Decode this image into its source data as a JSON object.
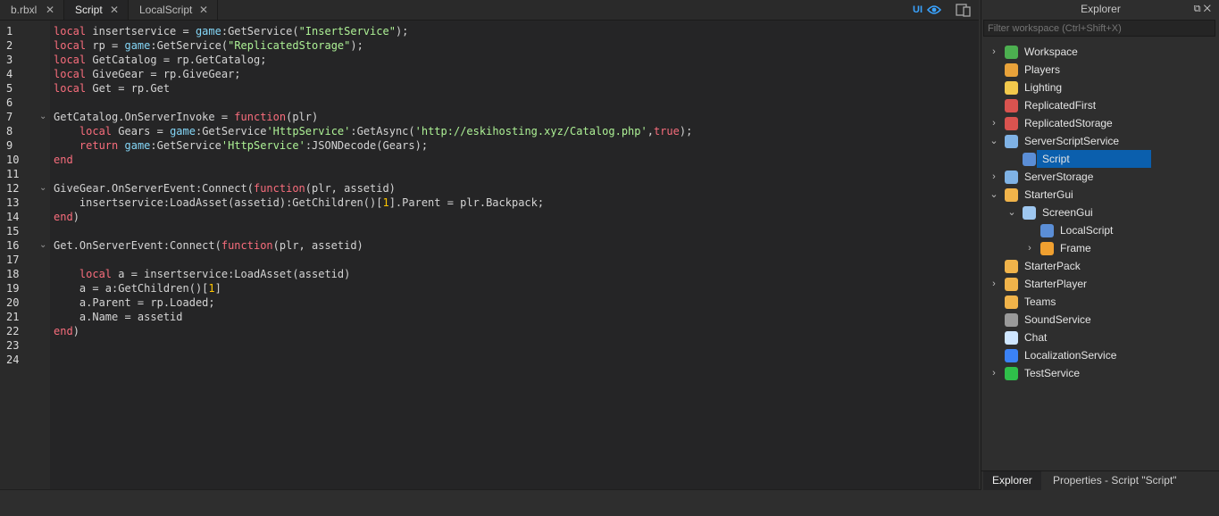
{
  "tabs": [
    {
      "label": "b.rbxl",
      "close": "✕"
    },
    {
      "label": "Script",
      "close": "✕"
    },
    {
      "label": "LocalScript",
      "close": "✕"
    }
  ],
  "toolbar": {
    "ui_toggle": "UI"
  },
  "editor": {
    "line_numbers": [
      "1",
      "2",
      "3",
      "4",
      "5",
      "6",
      "7",
      "8",
      "9",
      "10",
      "11",
      "12",
      "13",
      "14",
      "15",
      "16",
      "17",
      "18",
      "19",
      "20",
      "21",
      "22",
      "23",
      "24"
    ],
    "lines": [
      [
        {
          "t": "kw",
          "v": "local"
        },
        {
          "t": "op",
          "v": " insertservice = "
        },
        {
          "t": "gl",
          "v": "game"
        },
        {
          "t": "op",
          "v": ":GetService("
        },
        {
          "t": "st",
          "v": "\"InsertService\""
        },
        {
          "t": "op",
          "v": ");"
        }
      ],
      [
        {
          "t": "kw",
          "v": "local"
        },
        {
          "t": "op",
          "v": " rp = "
        },
        {
          "t": "gl",
          "v": "game"
        },
        {
          "t": "op",
          "v": ":GetService("
        },
        {
          "t": "st",
          "v": "\"ReplicatedStorage\""
        },
        {
          "t": "op",
          "v": ");"
        }
      ],
      [
        {
          "t": "kw",
          "v": "local"
        },
        {
          "t": "op",
          "v": " GetCatalog = rp.GetCatalog;"
        }
      ],
      [
        {
          "t": "kw",
          "v": "local"
        },
        {
          "t": "op",
          "v": " GiveGear = rp.GiveGear;"
        }
      ],
      [
        {
          "t": "kw",
          "v": "local"
        },
        {
          "t": "op",
          "v": " Get = rp.Get"
        }
      ],
      [],
      [
        {
          "t": "op",
          "v": "GetCatalog.OnServerInvoke = "
        },
        {
          "t": "kw",
          "v": "function"
        },
        {
          "t": "op",
          "v": "(plr)"
        }
      ],
      [
        {
          "t": "op",
          "v": "    "
        },
        {
          "t": "kw",
          "v": "local"
        },
        {
          "t": "op",
          "v": " Gears = "
        },
        {
          "t": "gl",
          "v": "game"
        },
        {
          "t": "op",
          "v": ":GetService"
        },
        {
          "t": "st",
          "v": "'HttpService'"
        },
        {
          "t": "op",
          "v": ":GetAsync("
        },
        {
          "t": "st",
          "v": "'http://eskihosting.xyz/Catalog.php'"
        },
        {
          "t": "op",
          "v": ","
        },
        {
          "t": "kw",
          "v": "true"
        },
        {
          "t": "op",
          "v": ");"
        }
      ],
      [
        {
          "t": "op",
          "v": "    "
        },
        {
          "t": "kw",
          "v": "return"
        },
        {
          "t": "op",
          "v": " "
        },
        {
          "t": "gl",
          "v": "game"
        },
        {
          "t": "op",
          "v": ":GetService"
        },
        {
          "t": "st",
          "v": "'HttpService'"
        },
        {
          "t": "op",
          "v": ":JSONDecode(Gears);"
        }
      ],
      [
        {
          "t": "kw",
          "v": "end"
        }
      ],
      [],
      [
        {
          "t": "op",
          "v": "GiveGear.OnServerEvent:Connect("
        },
        {
          "t": "kw",
          "v": "function"
        },
        {
          "t": "op",
          "v": "(plr, assetid)"
        }
      ],
      [
        {
          "t": "op",
          "v": "    insertservice:LoadAsset(assetid):GetChildren()["
        },
        {
          "t": "nm",
          "v": "1"
        },
        {
          "t": "op",
          "v": "].Parent = plr.Backpack;"
        }
      ],
      [
        {
          "t": "kw",
          "v": "end"
        },
        {
          "t": "op",
          "v": ")"
        }
      ],
      [],
      [
        {
          "t": "op",
          "v": "Get.OnServerEvent:Connect("
        },
        {
          "t": "kw",
          "v": "function"
        },
        {
          "t": "op",
          "v": "(plr, assetid)"
        }
      ],
      [],
      [
        {
          "t": "op",
          "v": "    "
        },
        {
          "t": "kw",
          "v": "local"
        },
        {
          "t": "op",
          "v": " a = insertservice:LoadAsset(assetid)"
        }
      ],
      [
        {
          "t": "op",
          "v": "    a = a:GetChildren()["
        },
        {
          "t": "nm",
          "v": "1"
        },
        {
          "t": "op",
          "v": "]"
        }
      ],
      [
        {
          "t": "op",
          "v": "    a.Parent = rp.Loaded;"
        }
      ],
      [
        {
          "t": "op",
          "v": "    a.Name = assetid"
        }
      ],
      [
        {
          "t": "kw",
          "v": "end"
        },
        {
          "t": "op",
          "v": ")"
        }
      ],
      [],
      []
    ],
    "fold_lines": [
      7,
      12,
      16
    ]
  },
  "explorer": {
    "title": "Explorer",
    "controls": "⧉ ✕",
    "filter_placeholder": "Filter workspace (Ctrl+Shift+X)",
    "items": [
      {
        "label": "Workspace",
        "depth": 0,
        "chev": "right",
        "icon": "workspace-icon",
        "color": "#4caf50"
      },
      {
        "label": "Players",
        "depth": 0,
        "chev": "",
        "icon": "players-icon",
        "color": "#e8a23a"
      },
      {
        "label": "Lighting",
        "depth": 0,
        "chev": "",
        "icon": "lighting-icon",
        "color": "#f2c94c"
      },
      {
        "label": "ReplicatedFirst",
        "depth": 0,
        "chev": "",
        "icon": "replicated-first-icon",
        "color": "#d9534f"
      },
      {
        "label": "ReplicatedStorage",
        "depth": 0,
        "chev": "right",
        "icon": "replicated-storage-icon",
        "color": "#d9534f"
      },
      {
        "label": "ServerScriptService",
        "depth": 0,
        "chev": "down",
        "icon": "server-script-service-icon",
        "color": "#7fb2e5"
      },
      {
        "label": "Script",
        "depth": 1,
        "chev": "",
        "icon": "script-icon",
        "color": "#5b8ed6",
        "selected": true
      },
      {
        "label": "ServerStorage",
        "depth": 0,
        "chev": "right",
        "icon": "server-storage-icon",
        "color": "#7fb2e5"
      },
      {
        "label": "StarterGui",
        "depth": 0,
        "chev": "down",
        "icon": "starter-gui-icon",
        "color": "#f0b34a"
      },
      {
        "label": "ScreenGui",
        "depth": 1,
        "chev": "down",
        "icon": "screen-gui-icon",
        "color": "#9ec7f0"
      },
      {
        "label": "LocalScript",
        "depth": 2,
        "chev": "",
        "icon": "local-script-icon",
        "color": "#5b8ed6"
      },
      {
        "label": "Frame",
        "depth": 2,
        "chev": "right",
        "icon": "frame-icon",
        "color": "#f0a030"
      },
      {
        "label": "StarterPack",
        "depth": 0,
        "chev": "",
        "icon": "starter-pack-icon",
        "color": "#f0b34a"
      },
      {
        "label": "StarterPlayer",
        "depth": 0,
        "chev": "right",
        "icon": "starter-player-icon",
        "color": "#f0b34a"
      },
      {
        "label": "Teams",
        "depth": 0,
        "chev": "",
        "icon": "teams-icon",
        "color": "#f0b34a"
      },
      {
        "label": "SoundService",
        "depth": 0,
        "chev": "",
        "icon": "sound-service-icon",
        "color": "#9a9a9a"
      },
      {
        "label": "Chat",
        "depth": 0,
        "chev": "",
        "icon": "chat-icon",
        "color": "#cfe6ff"
      },
      {
        "label": "LocalizationService",
        "depth": 0,
        "chev": "",
        "icon": "localization-service-icon",
        "color": "#3b82f6"
      },
      {
        "label": "TestService",
        "depth": 0,
        "chev": "right",
        "icon": "test-service-icon",
        "color": "#2fbf4a"
      }
    ],
    "bottom_tabs": [
      {
        "label": "Explorer"
      },
      {
        "label": "Properties - Script \"Script\""
      }
    ]
  },
  "colors": {
    "accent": "#3aa3ff",
    "selection": "#0b5fad",
    "keyword": "#f86d7c",
    "global": "#84d6f7",
    "string": "#adf195",
    "number": "#ffc600"
  }
}
